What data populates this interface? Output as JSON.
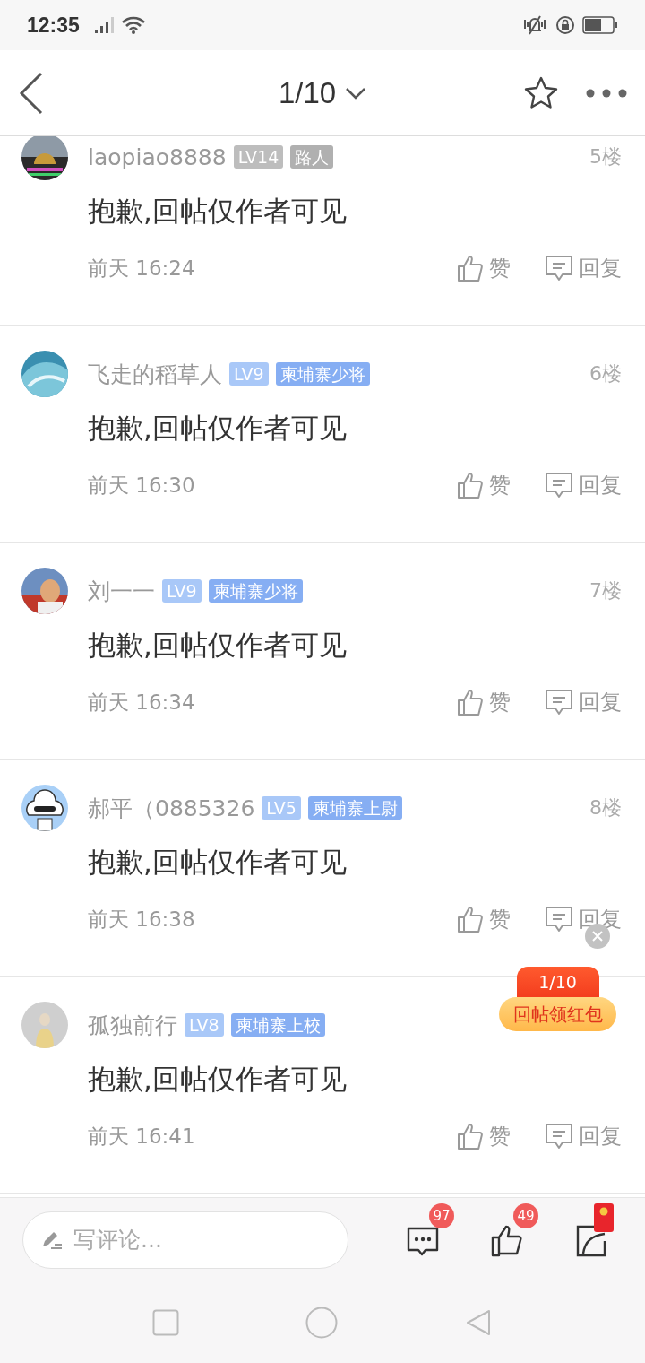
{
  "status_bar": {
    "time": "12:35"
  },
  "header": {
    "page": "1/10"
  },
  "posts": [
    {
      "user": "laopiao8888",
      "level": {
        "text": "LV14",
        "color": "#bdbdbd"
      },
      "rank": {
        "text": "路人",
        "color": "#b0b0b0"
      },
      "floor": "5楼",
      "content": "抱歉,回帖仅作者可见",
      "time": "前天 16:24",
      "like": "赞",
      "reply": "回复"
    },
    {
      "user": "飞走的稻草人",
      "level": {
        "text": "LV9",
        "color": "#a9c8f8"
      },
      "rank": {
        "text": "柬埔寨少将",
        "color": "#86aef3"
      },
      "floor": "6楼",
      "content": "抱歉,回帖仅作者可见",
      "time": "前天 16:30",
      "like": "赞",
      "reply": "回复"
    },
    {
      "user": "刘一一",
      "level": {
        "text": "LV9",
        "color": "#a9c8f8"
      },
      "rank": {
        "text": "柬埔寨少将",
        "color": "#86aef3"
      },
      "floor": "7楼",
      "content": "抱歉,回帖仅作者可见",
      "time": "前天 16:34",
      "like": "赞",
      "reply": "回复"
    },
    {
      "user": "郝平（0885326",
      "level": {
        "text": "LV5",
        "color": "#a9c8f8"
      },
      "rank": {
        "text": "柬埔寨上尉",
        "color": "#86aef3"
      },
      "floor": "8楼",
      "content": "抱歉,回帖仅作者可见",
      "time": "前天 16:38",
      "like": "赞",
      "reply": "回复"
    },
    {
      "user": "孤独前行",
      "level": {
        "text": "LV8",
        "color": "#a9c8f8"
      },
      "rank": {
        "text": "柬埔寨上校",
        "color": "#86aef3"
      },
      "content": "抱歉,回帖仅作者可见",
      "time": "前天 16:41",
      "like": "赞",
      "reply": "回复"
    }
  ],
  "red_packet": {
    "count": "1/10",
    "label": "回帖领红包"
  },
  "comment_bar": {
    "placeholder": "写评论...",
    "comments_badge": "97",
    "likes_badge": "49"
  }
}
